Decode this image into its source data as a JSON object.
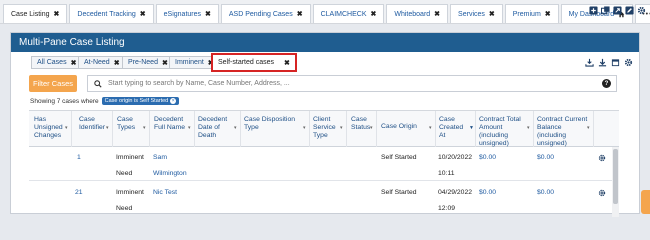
{
  "top_tabs": [
    {
      "label": "Case Listing",
      "active": true
    },
    {
      "label": "Decedent Tracking",
      "active": false
    },
    {
      "label": "eSignatures",
      "active": false
    },
    {
      "label": "ASD Pending Cases",
      "active": false
    },
    {
      "label": "CLAIMCHECK",
      "active": false
    },
    {
      "label": "Whiteboard",
      "active": false
    },
    {
      "label": "Services",
      "active": false
    },
    {
      "label": "Premium",
      "active": false
    },
    {
      "label": "My Dashboard",
      "active": false
    }
  ],
  "more_tabs_label": "•••",
  "close_glyph": "✖",
  "panel": {
    "title": "Multi-Pane Case Listing"
  },
  "sub_tabs": [
    {
      "label": "All Cases"
    },
    {
      "label": "At-Need"
    },
    {
      "label": "Pre-Need"
    },
    {
      "label": "Imminent"
    },
    {
      "label": "Self-started cases"
    }
  ],
  "filter_button": "Filter Cases",
  "search": {
    "placeholder": "Start typing to search by Name, Case Number, Address, ...",
    "help": "?"
  },
  "showing": {
    "text": "Showing 7 cases where",
    "chip": "Case origin is Self Started"
  },
  "columns": [
    {
      "label": "Has Unsigned Changes"
    },
    {
      "label": "Case Identifier"
    },
    {
      "label": "Case Types"
    },
    {
      "label": "Decedent Full Name"
    },
    {
      "label": "Decedent Date of Death"
    },
    {
      "label": "Case Disposition Type"
    },
    {
      "label": "Client Service Type"
    },
    {
      "label": "Case Status"
    },
    {
      "label": "Case Origin"
    },
    {
      "label": "Case Created At"
    },
    {
      "label": "Contract Total Amount (including unsigned)"
    },
    {
      "label": "Contract Current Balance (including unsigned)"
    }
  ],
  "rows": [
    {
      "id": "1",
      "type1": "Imminent",
      "type2": "Need",
      "name1": "Sam",
      "name2": "Wilmington",
      "origin": "Self Started",
      "date": "10/20/2022",
      "time": "10:11",
      "total": "$0.00",
      "balance": "$0.00"
    },
    {
      "id": "21",
      "type1": "Imminent",
      "type2": "Need",
      "name1": "Nic Test",
      "name2": "",
      "origin": "Self Started",
      "date": "04/29/2022",
      "time": "12:09",
      "total": "$0.00",
      "balance": "$0.00"
    }
  ],
  "colors": {
    "header_blue": "#1f5d90",
    "accent_orange": "#f4a54d",
    "link_blue": "#1e5aa0",
    "selected_outline": "#d62424"
  }
}
